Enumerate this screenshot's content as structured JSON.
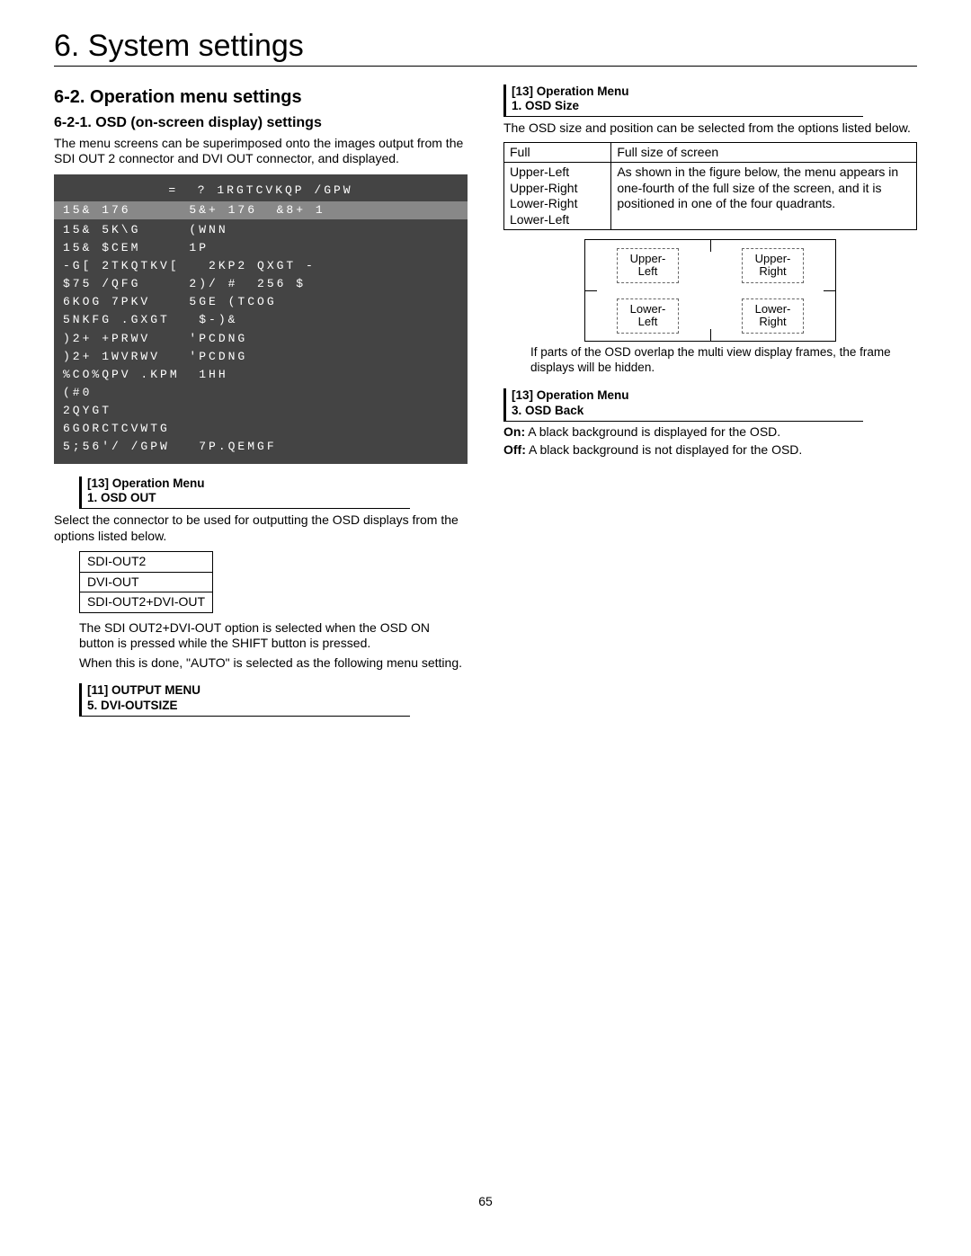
{
  "chapter_title": "6. System settings",
  "page_number": "65",
  "left": {
    "section_title": "6-2. Operation menu settings",
    "subsection_title": "6-2-1. OSD (on-screen display) settings",
    "intro": "The menu screens can be superimposed onto the images output from the SDI OUT 2 connector and DVI OUT connector, and displayed.",
    "menu_screen": {
      "header": "=  ? 1RGTCVKQP /GPW",
      "highlight": "15& 176      5&+ 176  &8+ 1",
      "lines": [
        "15& 5K\\G     (WNN",
        "15& $CEM     1P",
        "-G[ 2TKQTKV[   2KP2 QXGT -",
        "$75 /QFG     2)/ #  256 $",
        "6KOG 7PKV    5GE (TCOG",
        "5NKFG .GXGT   $-)&",
        ")2+ +PRWV    'PCDNG",
        ")2+ 1WVRWV   'PCDNG",
        "%CO%QPV .KPM  1HH",
        "(#0",
        "2QYGT",
        "6GORCTCVWTG",
        "5;56'/ /GPW   7P.QEMGF"
      ]
    },
    "ref1": {
      "line1": "[13] Operation Menu",
      "line2": "1. OSD OUT"
    },
    "after_ref1": "Select the connector to be used for outputting the OSD displays from the options listed below.",
    "out_table": [
      "SDI-OUT2",
      "DVI-OUT",
      "SDI-OUT2+DVI-OUT"
    ],
    "note1": "The SDI OUT2+DVI-OUT option is selected when the OSD ON button is pressed while the SHIFT button is pressed.",
    "note2": "When this is done, \"AUTO\" is selected as the following menu setting.",
    "ref2": {
      "line1": "[11] OUTPUT MENU",
      "line2": "5. DVI-OUTSIZE"
    }
  },
  "right": {
    "ref3": {
      "line1": "[13] Operation Menu",
      "line2": "1. OSD Size"
    },
    "size_intro": "The OSD size and position can be selected from the options listed below.",
    "size_table": {
      "full_label": "Full",
      "full_desc": "Full size of screen",
      "pos_labels": [
        "Upper-Left",
        "Upper-Right",
        "Lower-Right",
        "Lower-Left"
      ],
      "pos_desc": "As shown in the figure below, the menu appears in one-fourth of the full size of the screen, and it is positioned in one of the four quadrants."
    },
    "quadrants": {
      "ul": "Upper-\nLeft",
      "ur": "Upper-\nRight",
      "ll": "Lower-\nLeft",
      "lr": "Lower-\nRight"
    },
    "quad_note": "If parts of the OSD overlap the multi view display frames, the frame displays will be hidden.",
    "ref4": {
      "line1": "[13] Operation Menu",
      "line2": "3. OSD Back"
    },
    "back_on_label": "On:",
    "back_on": "A black background is displayed for the OSD.",
    "back_off_label": "Off:",
    "back_off": "A black background is not displayed for the OSD."
  }
}
